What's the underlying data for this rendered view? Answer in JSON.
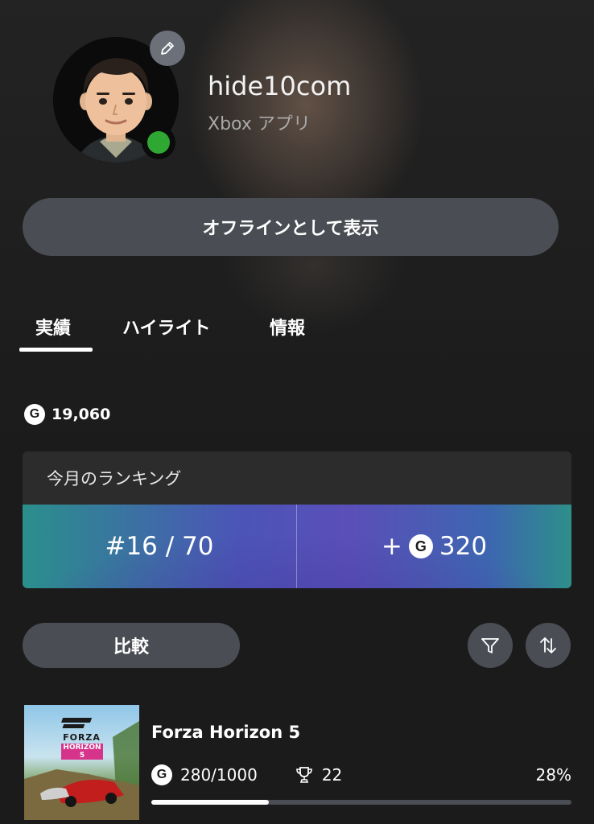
{
  "profile": {
    "gamertag": "hide10com",
    "app_name": "Xbox アプリ",
    "presence": "online",
    "presence_color": "#2ea833"
  },
  "actions": {
    "appear_offline_label": "オフラインとして表示",
    "compare_label": "比較"
  },
  "tabs": [
    {
      "label": "実績",
      "selected": true
    },
    {
      "label": "ハイライト",
      "selected": false
    },
    {
      "label": "情報",
      "selected": false
    }
  ],
  "gamerscore": {
    "icon": "G",
    "value": "19,060"
  },
  "ranking": {
    "title": "今月のランキング",
    "rank": "#16 / 70",
    "gain_prefix": "+",
    "gain_icon": "G",
    "gain_value": "320"
  },
  "toolbar": {
    "filter_icon": "filter-icon",
    "sort_icon": "sort-icon"
  },
  "games": [
    {
      "title": "Forza Horizon 5",
      "thumb_logo_line1": "FORZA",
      "thumb_logo_line2": "HORIZON 5",
      "gamerscore_icon": "G",
      "gamerscore": "280/1000",
      "achievements": "22",
      "percent_text": "28%",
      "progress": 0.28
    }
  ]
}
